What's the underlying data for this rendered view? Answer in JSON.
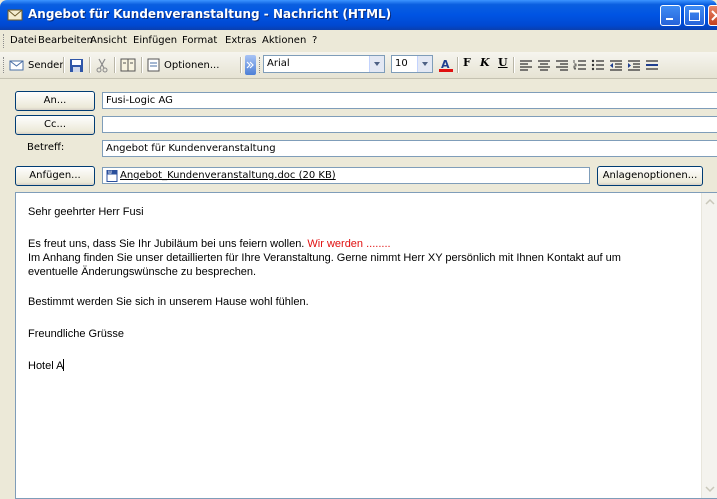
{
  "window": {
    "title": "Angebot für Kundenveranstaltung - Nachricht (HTML)",
    "icon": "mail-envelope-icon"
  },
  "menu": {
    "items": [
      "Datei",
      "Bearbeiten",
      "Ansicht",
      "Einfügen",
      "Format",
      "Extras",
      "Aktionen",
      "?"
    ]
  },
  "toolbar": {
    "send_label": "Senden",
    "options_label": "Optionen...",
    "font": "Arial",
    "size": "10",
    "bold": "F",
    "italic": "K",
    "underline": "U",
    "accent_color": "#e01010"
  },
  "header": {
    "to_button": "An...",
    "cc_button": "Cc...",
    "subject_label": "Betreff:",
    "attach_button": "Anfügen...",
    "attach_options_button": "Anlagenoptionen...",
    "to_value": "Fusi-Logic AG",
    "cc_value": "",
    "subject_value": "Angebot für Kundenveranstaltung",
    "attachment": "Angebot_Kundenveranstaltung.doc (20 KB)"
  },
  "message": {
    "greeting": "Sehr geehrter Herr Fusi",
    "line1": "Es freut uns, dass Sie Ihr Jubiläum bei uns feiern wollen. ",
    "line1_red": "Wir werden ........",
    "line2": "Im Anhang finden Sie unser detaillierten für Ihre Veranstaltung. Gerne nimmt Herr XY persönlich mit Ihnen Kontakt auf um",
    "line3": "eventuelle Änderungswünsche zu besprechen.",
    "line4": "Bestimmt werden Sie sich in unserem Hause wohl fühlen.",
    "closing": "Freundliche Grüsse",
    "signature": "Hotel A"
  }
}
